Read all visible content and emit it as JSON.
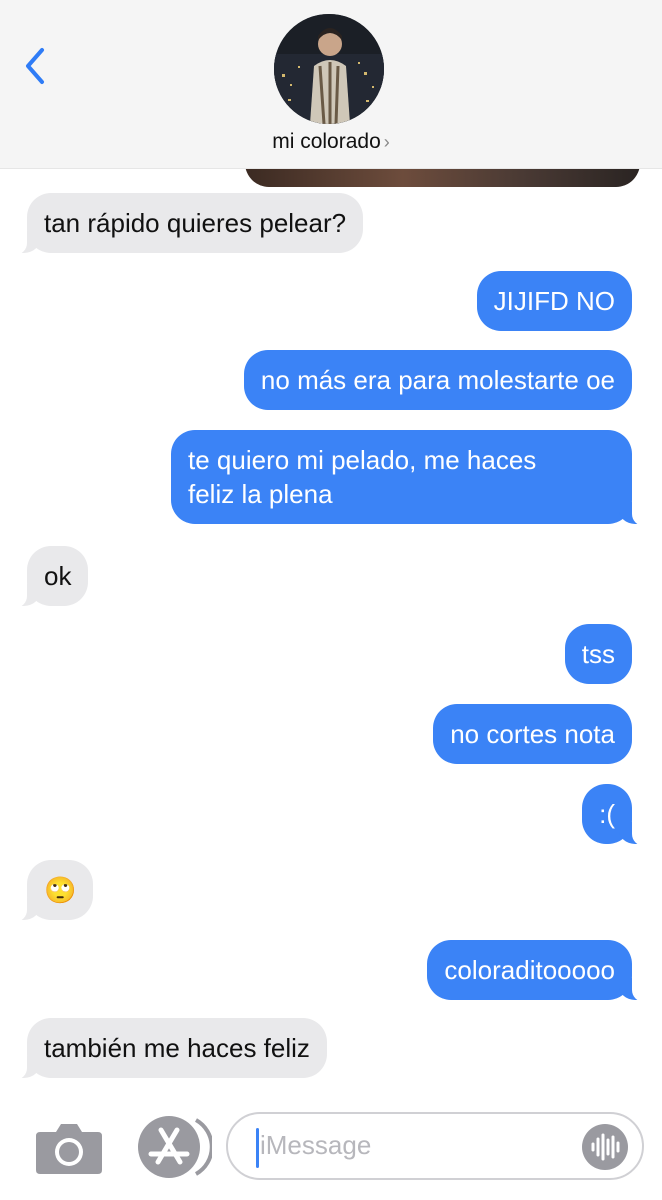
{
  "header": {
    "contact_name": "mi colorado",
    "chevron": "›"
  },
  "messages": [
    {
      "id": 1,
      "dir": "in",
      "text": "tan rápido quieres pelear?"
    },
    {
      "id": 2,
      "dir": "out",
      "text": "JIJIFD NO"
    },
    {
      "id": 3,
      "dir": "out",
      "text": "no más era para molestarte oe"
    },
    {
      "id": 4,
      "dir": "out",
      "text": "te quiero mi pelado, me haces",
      "text2": "feliz la plena"
    },
    {
      "id": 5,
      "dir": "in",
      "text": "ok"
    },
    {
      "id": 6,
      "dir": "out",
      "text": "tss"
    },
    {
      "id": 7,
      "dir": "out",
      "text": "no cortes nota"
    },
    {
      "id": 8,
      "dir": "out",
      "text": ":("
    },
    {
      "id": 9,
      "dir": "in",
      "text": "🙄"
    },
    {
      "id": 10,
      "dir": "out",
      "text": "coloraditooooo"
    },
    {
      "id": 11,
      "dir": "in",
      "text": "también me haces feliz"
    }
  ],
  "composer": {
    "placeholder": "iMessage",
    "camera_icon": "camera-icon",
    "apps_icon": "app-store-icon",
    "audio_icon": "audio-waveform-icon"
  },
  "colors": {
    "outgoing_bubble": "#3b83f6",
    "incoming_bubble": "#e9e9eb",
    "accent": "#2f7cf6"
  }
}
